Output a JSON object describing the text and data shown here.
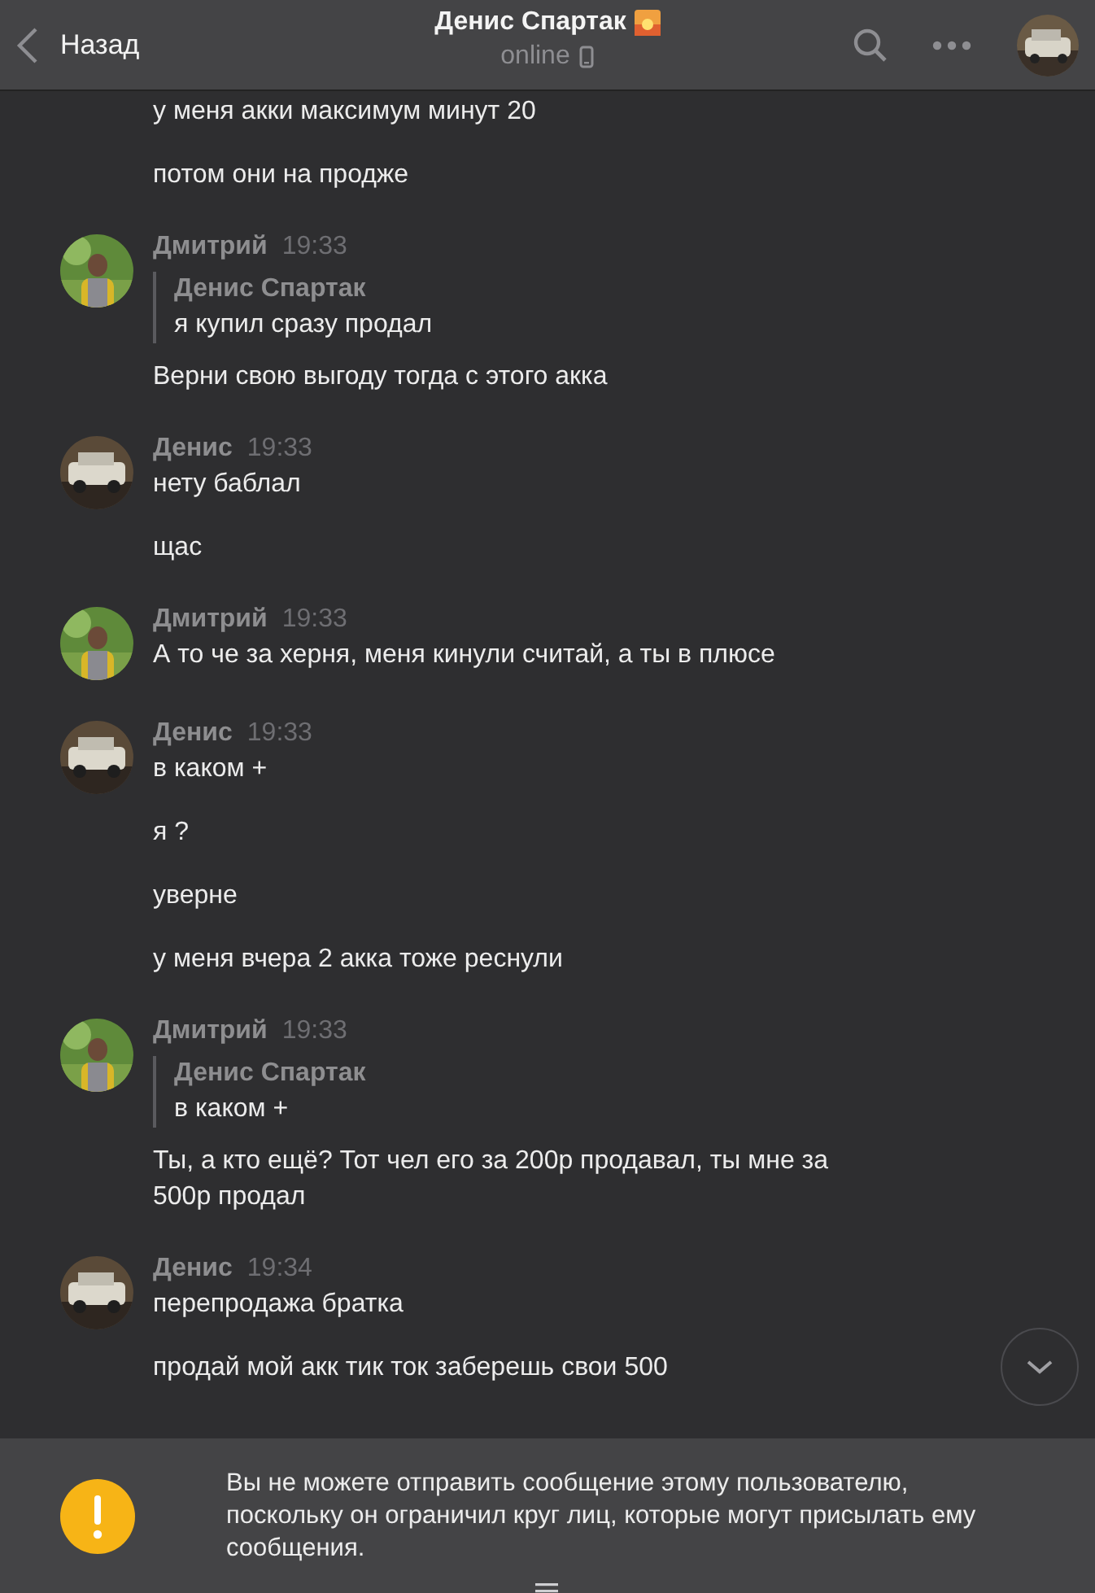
{
  "header": {
    "back_label": "Назад",
    "title": "Денис Спартак",
    "status": "online"
  },
  "earlier_messages": [
    {
      "text": "у меня акки максимум минут 20"
    },
    {
      "text": "потом они на продже"
    }
  ],
  "groups": [
    {
      "author": "Дмитрий",
      "time": "19:33",
      "messages": [
        {
          "reply": {
            "author": "Денис Спартак",
            "text": "я купил сразу продал"
          },
          "text": "Верни свою выгоду тогда с этого акка"
        }
      ]
    },
    {
      "author": "Денис",
      "time": "19:33",
      "messages": [
        {
          "text": "нету баблал"
        },
        {
          "text": "щас"
        }
      ]
    },
    {
      "author": "Дмитрий",
      "time": "19:33",
      "messages": [
        {
          "text": "А то че за херня, меня кинули считай, а ты в плюсе"
        }
      ]
    },
    {
      "author": "Денис",
      "time": "19:33",
      "messages": [
        {
          "text": "в каком +"
        },
        {
          "text": "я ?"
        },
        {
          "text": "уверне"
        },
        {
          "text": "у меня вчера 2 акка тоже реснули"
        }
      ]
    },
    {
      "author": "Дмитрий",
      "time": "19:33",
      "messages": [
        {
          "reply": {
            "author": "Денис Спартак",
            "text": "в каком +"
          },
          "text": "Ты, а кто ещё? Тот чел его за 200р продавал, ты мне за 500р продал"
        }
      ]
    },
    {
      "author": "Денис",
      "time": "19:34",
      "messages": [
        {
          "text": "перепродажа братка"
        },
        {
          "text": "продай мой акк тик ток заберешь свои 500"
        }
      ]
    }
  ],
  "notice": {
    "text": "Вы не можете отправить сообщение этому пользователю, поскольку он ограничил круг лиц, которые могут присылать ему сообщения."
  }
}
